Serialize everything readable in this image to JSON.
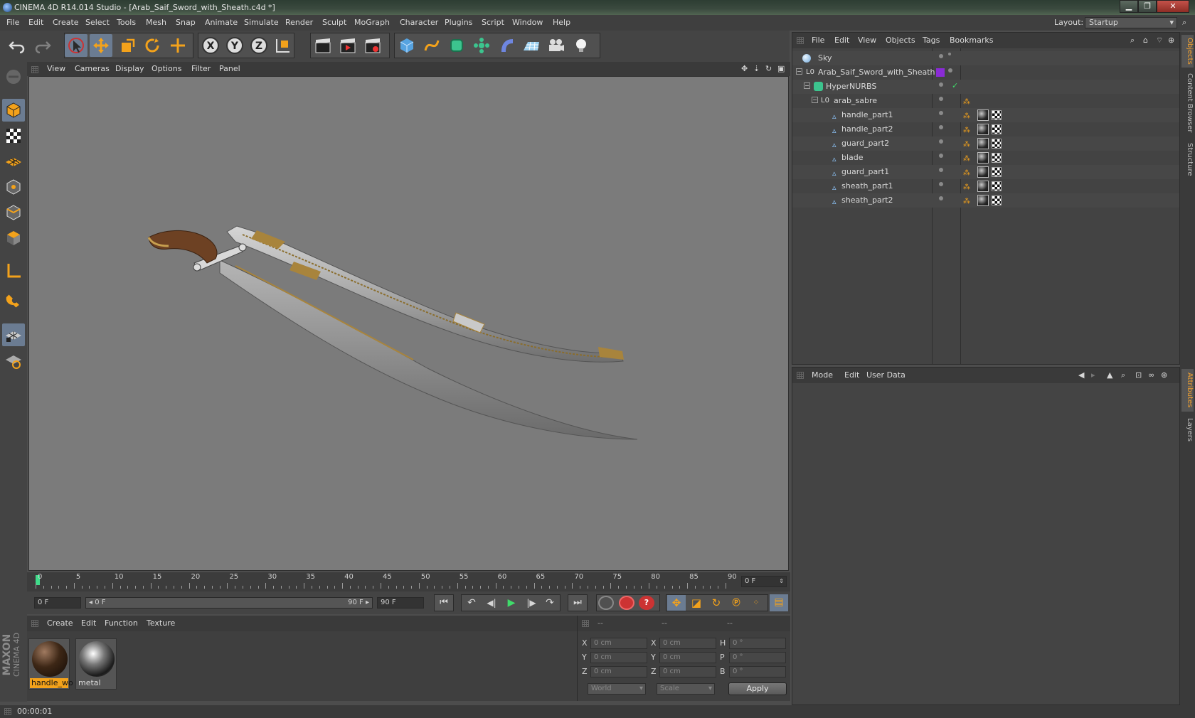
{
  "window": {
    "title": "CINEMA 4D R14.014 Studio - [Arab_Saif_Sword_with_Sheath.c4d *]"
  },
  "menubar": {
    "items": [
      "File",
      "Edit",
      "Create",
      "Select",
      "Tools",
      "Mesh",
      "Snap",
      "Animate",
      "Simulate",
      "Render",
      "Sculpt",
      "MoGraph",
      "Character",
      "Plugins",
      "Script",
      "Window",
      "Help"
    ],
    "layout_label": "Layout:",
    "layout_value": "Startup"
  },
  "viewport_menu": {
    "items": [
      "View",
      "Cameras",
      "Display",
      "Options",
      "Filter",
      "Panel"
    ]
  },
  "timeline": {
    "ticks": [
      "0",
      "5",
      "10",
      "15",
      "20",
      "25",
      "30",
      "35",
      "40",
      "45",
      "50",
      "55",
      "60",
      "65",
      "70",
      "75",
      "80",
      "85",
      "90"
    ],
    "current_frame": "0 F"
  },
  "transport": {
    "start_field": "0 F",
    "range_start": "◂ 0 F",
    "range_end": "90 F ▸",
    "end_field": "90 F"
  },
  "object_manager": {
    "menu": [
      "File",
      "Edit",
      "View",
      "Objects",
      "Tags",
      "Bookmarks"
    ],
    "objects": [
      {
        "name": "Sky",
        "depth": 0
      },
      {
        "name": "Arab_Saif_Sword_with_Sheath",
        "depth": 0
      },
      {
        "name": "HyperNURBS",
        "depth": 1
      },
      {
        "name": "arab_sabre",
        "depth": 2
      },
      {
        "name": "handle_part1",
        "depth": 3
      },
      {
        "name": "handle_part2",
        "depth": 3
      },
      {
        "name": "guard_part2",
        "depth": 3
      },
      {
        "name": "blade",
        "depth": 3
      },
      {
        "name": "guard_part1",
        "depth": 3
      },
      {
        "name": "sheath_part1",
        "depth": 3
      },
      {
        "name": "sheath_part2",
        "depth": 3
      }
    ]
  },
  "attribute_manager": {
    "menu": [
      "Mode",
      "Edit",
      "User Data"
    ]
  },
  "right_tabs": [
    "Objects",
    "Content Browser",
    "Structure",
    "Attributes",
    "Layers"
  ],
  "material_manager": {
    "menu": [
      "Create",
      "Edit",
      "Function",
      "Texture"
    ],
    "materials": [
      {
        "name": "handle_wo"
      },
      {
        "name": "metal"
      }
    ]
  },
  "coordinates": {
    "headers": [
      "--",
      "--",
      "--"
    ],
    "rows": [
      {
        "a": "X",
        "av": "0 cm",
        "b": "X",
        "bv": "0 cm",
        "c": "H",
        "cv": "0 °"
      },
      {
        "a": "Y",
        "av": "0 cm",
        "b": "Y",
        "bv": "0 cm",
        "c": "P",
        "cv": "0 °"
      },
      {
        "a": "Z",
        "av": "0 cm",
        "b": "Z",
        "bv": "0 cm",
        "c": "B",
        "cv": "0 °"
      }
    ],
    "world": "World",
    "scale": "Scale",
    "apply": "Apply"
  },
  "status": {
    "time": "00:00:01"
  },
  "brand": {
    "line1": "MAXON",
    "line2": "CINEMA 4D"
  }
}
